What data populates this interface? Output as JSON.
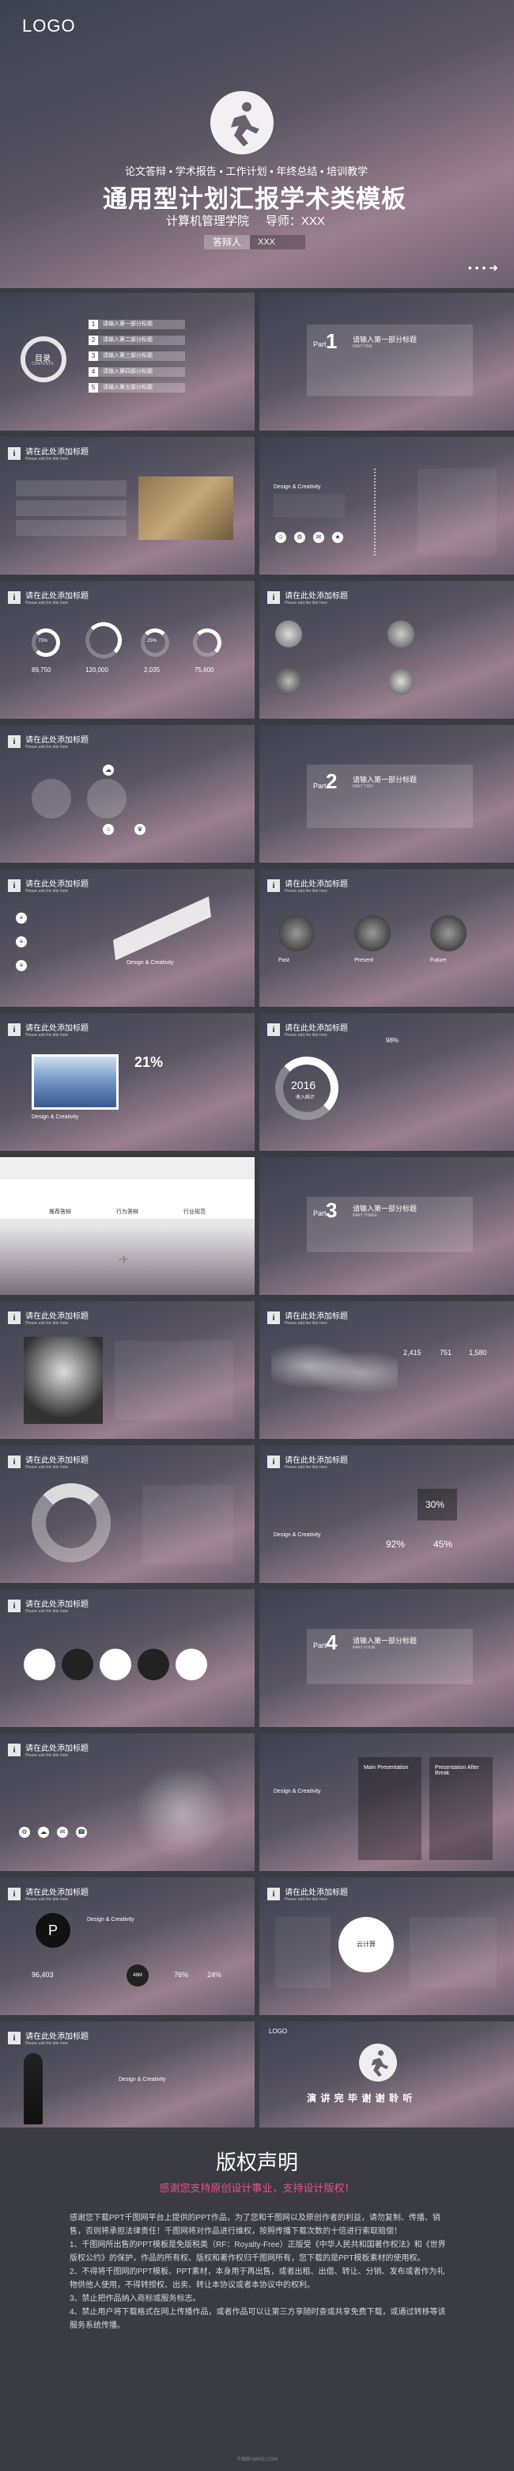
{
  "cover": {
    "logo": "LOGO",
    "subtitle": "论文答辩 • 学术报告 • 工作计划 • 年终总结 • 培训教学",
    "title": "通用型计划汇报学术类模板",
    "institution": "计算机管理学院",
    "advisor": "导师：XXX",
    "respondent_label": "答辩人",
    "respondent_value": "XXX",
    "next_icon": "arrow-right-icon"
  },
  "toc": {
    "label": "目录",
    "sublabel": "CONTENTS",
    "items": [
      "请输入第一部分标题",
      "请输入第二部分标题",
      "请输入第三部分标题",
      "请输入第四部分标题",
      "请输入第五部分标题"
    ],
    "numbers": [
      "1",
      "2",
      "3",
      "4",
      "5"
    ]
  },
  "parts": [
    {
      "part": "Part",
      "num": "1",
      "title": "请输入第一部分标题",
      "sub": "PART ONE"
    },
    {
      "part": "Part",
      "num": "2",
      "title": "请输入第一部分标题",
      "sub": "PART TWO"
    },
    {
      "part": "Part",
      "num": "3",
      "title": "请输入第一部分标题",
      "sub": "PART THREE"
    },
    {
      "part": "Part",
      "num": "4",
      "title": "请输入第一部分标题",
      "sub": "PART FOUR"
    }
  ],
  "slide_head": {
    "title": "请在此处添加标题",
    "sub": "Please add the title here"
  },
  "slide_texts": {
    "design": "Design & Creativity",
    "past": "Past",
    "present": "Present",
    "future": "Future",
    "main_presentation": "Main Presentation",
    "after_break": "Presentation After Break"
  },
  "stats": {
    "pct1": "75%",
    "pct2": "50%",
    "pct3": "25%",
    "v1": "89,750",
    "v2": "120,000",
    "v3": "2,035",
    "v4": "75,600",
    "percent21": "21%",
    "year": "2016",
    "year_sub": "收入统计",
    "pct98": "98%",
    "s2415": "2,415",
    "s751": "751",
    "s1580": "1,580",
    "pct30": "30%",
    "pct92": "92%",
    "pct45": "45%",
    "v96": "96,403",
    "v48": "48M",
    "v76": "76%",
    "v24": "24%",
    "cloud": "云计算"
  },
  "tabs": [
    "推荐答辩",
    "行为答辩",
    "行业规范"
  ],
  "ending": {
    "logo": "LOGO",
    "text": "演 讲 完 毕   谢 谢 聆 听"
  },
  "copyright": {
    "heading": "版权声明",
    "subheading": "感谢您支持原创设计事业，支持设计版权！",
    "paragraphs": [
      "感谢您下载PPT千图网平台上提供的PPT作品，为了您和千图网以及原创作者的利益，请勿复制、传播、销售，否则将承担法律责任！千图网将对作品进行维权，按照传播下载次数的十倍进行索取赔偿！",
      "1、千图网所出售的PPT模板是免版税类（RF：Royalty-Free）正版受《中华人民共和国著作权法》和《世界版权公约》的保护，作品的所有权、版权和著作权归千图网所有，您下载的是PPT模板素材的使用权。",
      "2、不得将千图网的PPT模板、PPT素材，本身用于再出售，或者出租、出借、转让、分销、发布或者作为礼物供他人使用，不得转授权、出卖、转让本协议或者本协议中的权利。",
      "3、禁止把作品纳入商标或服务标志。",
      "4、禁止用户将下载格式在网上传播作品，或者作品可以让第三方享随时查或共享免费下载，或通过转移等该服务系统传播。"
    ],
    "footer": "千图网 58PIC.COM"
  }
}
